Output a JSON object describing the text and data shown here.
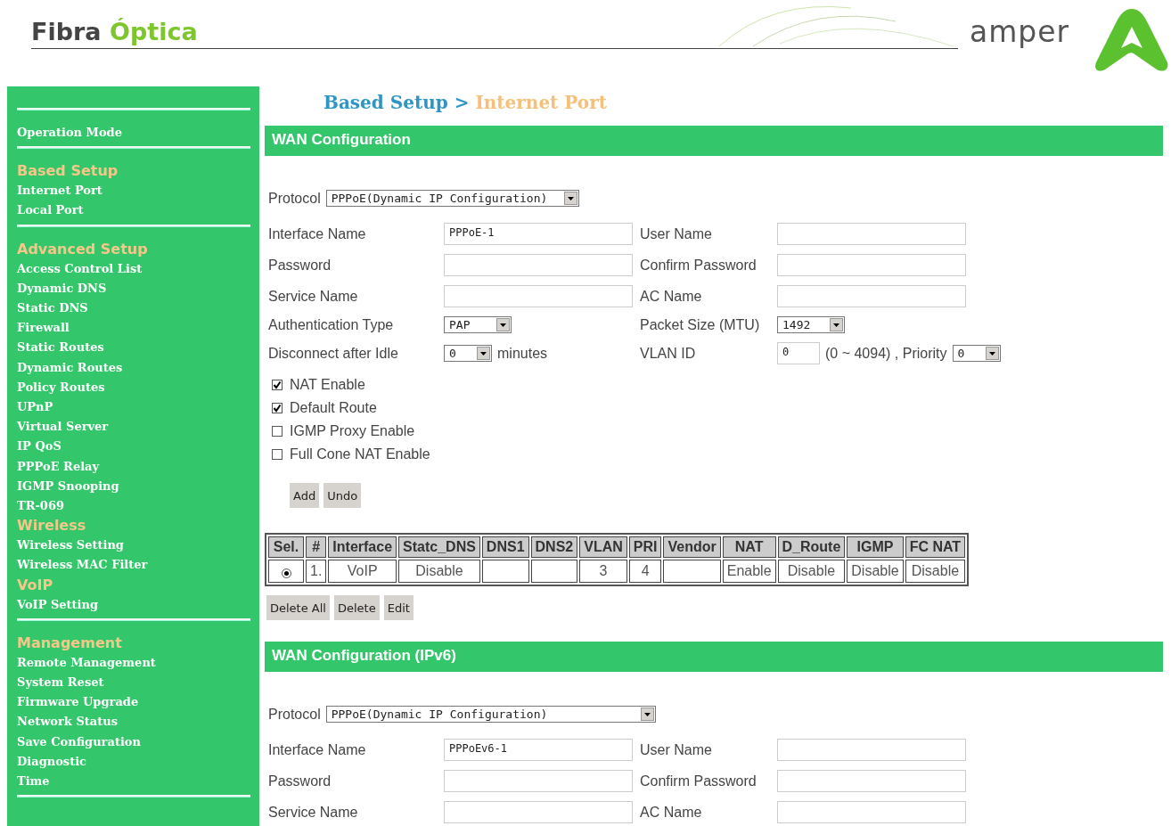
{
  "header": {
    "title_part1": "Fibra",
    "title_part2": "Óptica",
    "brand": "amper"
  },
  "sidebar": [
    {
      "kind": "divider"
    },
    {
      "kind": "link",
      "label": "Operation Mode"
    },
    {
      "kind": "divider"
    },
    {
      "kind": "heading",
      "label": "Based Setup"
    },
    {
      "kind": "link",
      "label": "Internet Port"
    },
    {
      "kind": "link",
      "label": "Local Port"
    },
    {
      "kind": "divider"
    },
    {
      "kind": "heading",
      "label": "Advanced Setup"
    },
    {
      "kind": "link",
      "label": "Access Control List"
    },
    {
      "kind": "link",
      "label": "Dynamic DNS"
    },
    {
      "kind": "link",
      "label": "Static DNS"
    },
    {
      "kind": "link",
      "label": "Firewall"
    },
    {
      "kind": "link",
      "label": "Static Routes"
    },
    {
      "kind": "link",
      "label": "Dynamic Routes"
    },
    {
      "kind": "link",
      "label": "Policy Routes"
    },
    {
      "kind": "link",
      "label": "UPnP"
    },
    {
      "kind": "link",
      "label": "Virtual Server"
    },
    {
      "kind": "link",
      "label": "IP QoS"
    },
    {
      "kind": "link",
      "label": "PPPoE Relay"
    },
    {
      "kind": "link",
      "label": "IGMP Snooping"
    },
    {
      "kind": "link",
      "label": "TR-069"
    },
    {
      "kind": "heading",
      "label": "Wireless"
    },
    {
      "kind": "link",
      "label": "Wireless Setting"
    },
    {
      "kind": "link",
      "label": "Wireless MAC Filter"
    },
    {
      "kind": "heading",
      "label": "VoIP"
    },
    {
      "kind": "link",
      "label": "VoIP Setting"
    },
    {
      "kind": "divider"
    },
    {
      "kind": "heading",
      "label": "Management"
    },
    {
      "kind": "link",
      "label": "Remote Management"
    },
    {
      "kind": "link",
      "label": "System Reset"
    },
    {
      "kind": "link",
      "label": "Firmware Upgrade"
    },
    {
      "kind": "link",
      "label": "Network Status"
    },
    {
      "kind": "link",
      "label": "Save Configuration"
    },
    {
      "kind": "link",
      "label": "Diagnostic"
    },
    {
      "kind": "link",
      "label": "Time"
    },
    {
      "kind": "divider"
    }
  ],
  "breadcrumb": {
    "parent": "Based Setup",
    "separator": ">",
    "current": "Internet Port"
  },
  "wan": {
    "title": "WAN Configuration",
    "protocol": {
      "label": "Protocol",
      "value": "PPPoE(Dynamic IP Configuration)"
    },
    "rows": [
      [
        {
          "label": "Interface Name",
          "controls": [
            {
              "kind": "input",
              "value": "PPPoE-1"
            }
          ]
        },
        {
          "label": "User Name",
          "controls": [
            {
              "kind": "input"
            }
          ]
        }
      ],
      [
        {
          "label": "Password",
          "controls": [
            {
              "kind": "input"
            }
          ]
        },
        {
          "label": "Confirm Password",
          "controls": [
            {
              "kind": "input"
            }
          ]
        }
      ],
      [
        {
          "label": "Service Name",
          "controls": [
            {
              "kind": "input"
            }
          ]
        },
        {
          "label": "AC Name",
          "controls": [
            {
              "kind": "input"
            }
          ]
        }
      ],
      [
        {
          "label": "Authentication Type",
          "controls": [
            {
              "kind": "select",
              "value": "PAP"
            }
          ]
        },
        {
          "label": "Packet Size (MTU)",
          "controls": [
            {
              "kind": "select",
              "value": "1492"
            }
          ]
        }
      ],
      [
        {
          "label": "Disconnect after Idle",
          "controls": [
            {
              "kind": "select_small",
              "value": "0"
            },
            {
              "kind": "text",
              "text": "minutes"
            }
          ]
        },
        {
          "label": "VLAN ID",
          "controls": [
            {
              "kind": "input_small",
              "value": "0"
            },
            {
              "kind": "text",
              "text": "(0 ~ 4094) , Priority"
            },
            {
              "kind": "select_small",
              "value": "0"
            }
          ]
        }
      ]
    ],
    "checkboxes": [
      {
        "label": "NAT Enable",
        "checked": true
      },
      {
        "label": "Default Route",
        "checked": true
      },
      {
        "label": "IGMP Proxy Enable",
        "checked": false
      },
      {
        "label": "Full Cone NAT Enable",
        "checked": false
      }
    ],
    "buttons": [
      "Add",
      "Undo"
    ],
    "table": {
      "columns": [
        "Sel.",
        "#",
        "Interface",
        "Statc_DNS",
        "DNS1",
        "DNS2",
        "VLAN",
        "PRI",
        "Vendor",
        "NAT",
        "D_Route",
        "IGMP",
        "FC NAT"
      ],
      "rows": [
        {
          "selected": true,
          "cells": [
            null,
            "1.",
            "VoIP",
            "Disable",
            null,
            null,
            "3",
            "4",
            null,
            "Enable",
            "Disable",
            "Disable",
            "Disable"
          ]
        }
      ]
    },
    "table_buttons": [
      "Delete All",
      "Delete",
      "Edit"
    ]
  },
  "wan6": {
    "title": "WAN Configuration (IPv6)",
    "protocol": {
      "label": "Protocol",
      "value": "PPPoE(Dynamic IP Configuration)"
    },
    "rows": [
      [
        {
          "label": "Interface Name",
          "controls": [
            {
              "kind": "input",
              "value": "PPPoEv6-1"
            }
          ]
        },
        {
          "label": "User Name",
          "controls": [
            {
              "kind": "input"
            }
          ]
        }
      ],
      [
        {
          "label": "Password",
          "controls": [
            {
              "kind": "input"
            }
          ]
        },
        {
          "label": "Confirm Password",
          "controls": [
            {
              "kind": "input"
            }
          ]
        }
      ],
      [
        {
          "label": "Service Name",
          "controls": [
            {
              "kind": "input"
            }
          ]
        },
        {
          "label": "AC Name",
          "controls": [
            {
              "kind": "input"
            }
          ]
        }
      ]
    ]
  }
}
